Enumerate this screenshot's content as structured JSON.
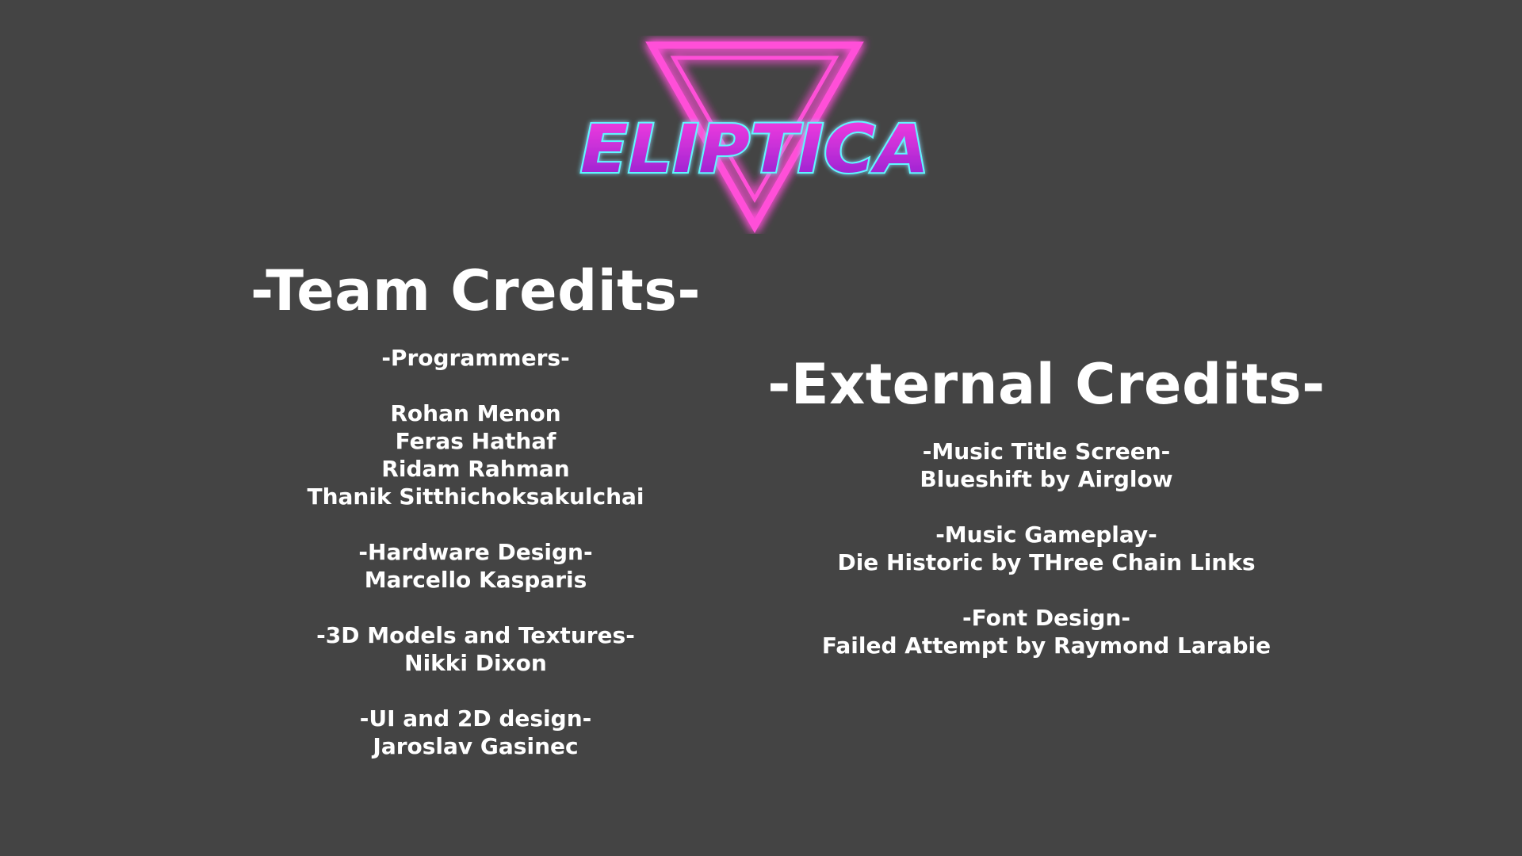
{
  "logo": {
    "text": "ELIPTICA",
    "colors": {
      "triangle": "#ff4fd8",
      "triangle_glow": "#ff00cc",
      "text_outline": "#5ff7ff",
      "text_fill_top": "#ff3fe0",
      "text_fill_bottom": "#8a1fd0"
    }
  },
  "team": {
    "heading": "-Team Credits-",
    "programmers": {
      "title": "-Programmers-",
      "names": [
        "Rohan Menon",
        "Feras Hathaf",
        "Ridam Rahman",
        "Thanik Sitthichoksakulchai"
      ]
    },
    "hardware": {
      "title": "-Hardware Design-",
      "name": "Marcello Kasparis"
    },
    "models": {
      "title": "-3D Models and Textures-",
      "name": "Nikki Dixon"
    },
    "ui": {
      "title": "-UI and 2D design-",
      "name": "Jaroslav Gasinec"
    }
  },
  "external": {
    "heading": "-External Credits-",
    "music_title": {
      "title": "-Music Title Screen-",
      "credit": "Blueshift by Airglow"
    },
    "music_gameplay": {
      "title": "-Music Gameplay-",
      "credit": "Die Historic by THree Chain Links"
    },
    "font": {
      "title": "-Font Design-",
      "credit": "Failed Attempt by Raymond Larabie"
    }
  }
}
